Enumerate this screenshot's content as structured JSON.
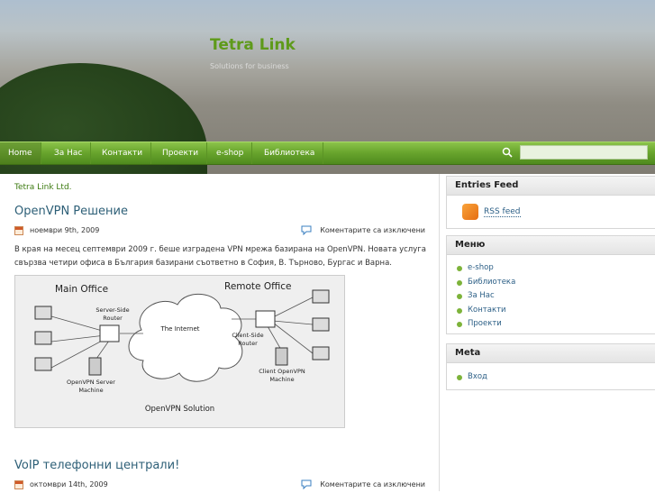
{
  "header": {
    "site_title": "Tetra Link",
    "site_description": "Solutions for business"
  },
  "nav": {
    "items": [
      "Home",
      "За Нас",
      "Контакти",
      "Проекти",
      "e-shop",
      "Библиотека"
    ],
    "active": "Home",
    "search_placeholder": ""
  },
  "main": {
    "breadcrumb": "Tetra Link Ltd.",
    "posts": [
      {
        "title": "OpenVPN Решение",
        "date": "ноември 9th, 2009",
        "comments": "Коментарите са изключени",
        "text": "В края на месец септември 2009 г. беше изградена VPN мрежа базирана на OpenVPN. Новата услуга свързва четири офиса в България базирани съответно в София, В. Търново, Бургас и Варна."
      },
      {
        "title": "VoIP телефонни централи!",
        "date": "октомври 14th, 2009",
        "comments": "Коментарите са изключени"
      }
    ],
    "diagram": {
      "main_office": "Main Office",
      "remote_office": "Remote Office",
      "server_side_router": "Server-Side Router",
      "internet": "The Internet",
      "client_side_router": "Client-Side Router",
      "openvpn_server": "OpenVPN Server Machine",
      "client_openvpn": "Client OpenVPN Machine",
      "caption": "OpenVPN Solution"
    }
  },
  "sidebar": {
    "entries_feed": {
      "title": "Entries Feed",
      "link": "RSS feed"
    },
    "menu": {
      "title": "Меню",
      "items": [
        "e-shop",
        "Библиотека",
        "За Нас",
        "Контакти",
        "Проекти"
      ]
    },
    "meta": {
      "title": "Meta",
      "items": [
        "Вход"
      ]
    }
  },
  "colors": {
    "nav_green": "#6aa62e",
    "title_green": "#5e9a1a",
    "link_blue": "#2c5f86",
    "bullet_green": "#7db33a"
  }
}
